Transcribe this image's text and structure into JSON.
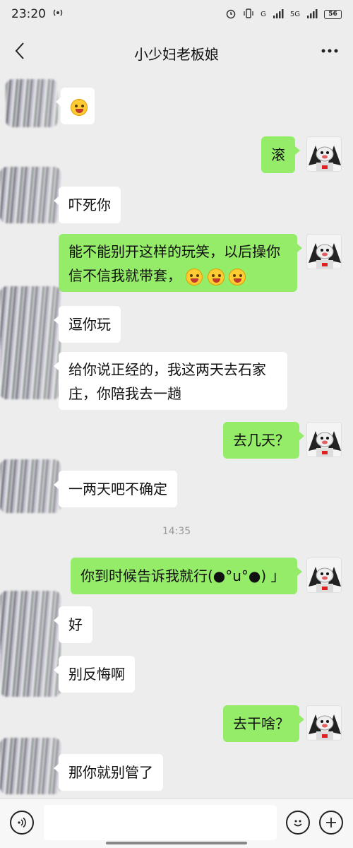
{
  "status_bar": {
    "time": "23:20",
    "network_1": "G",
    "network_2": "5G",
    "battery": "56"
  },
  "header": {
    "title": "小少妇老板娘"
  },
  "messages": [
    {
      "text": ""
    },
    {
      "text": "滚"
    },
    {
      "text": "吓死你"
    },
    {
      "text": "能不能别开这样的玩笑，以后操你信不信我就带套，"
    },
    {
      "text": "逗你玩"
    },
    {
      "text": "给你说正经的，我这两天去石家庄，你陪我去一趟"
    },
    {
      "text": "去几天？"
    },
    {
      "text": "一两天吧不确定"
    },
    {
      "text": "你到时候告诉我就行(●°u°●) 」"
    },
    {
      "text": "好"
    },
    {
      "text": "别反悔啊"
    },
    {
      "text": "去干啥？"
    },
    {
      "text": "那你就别管了"
    }
  ],
  "timestamp": "14:35",
  "colors": {
    "background": "#ededed",
    "bubble_in": "#ffffff",
    "bubble_out": "#95ec69"
  }
}
